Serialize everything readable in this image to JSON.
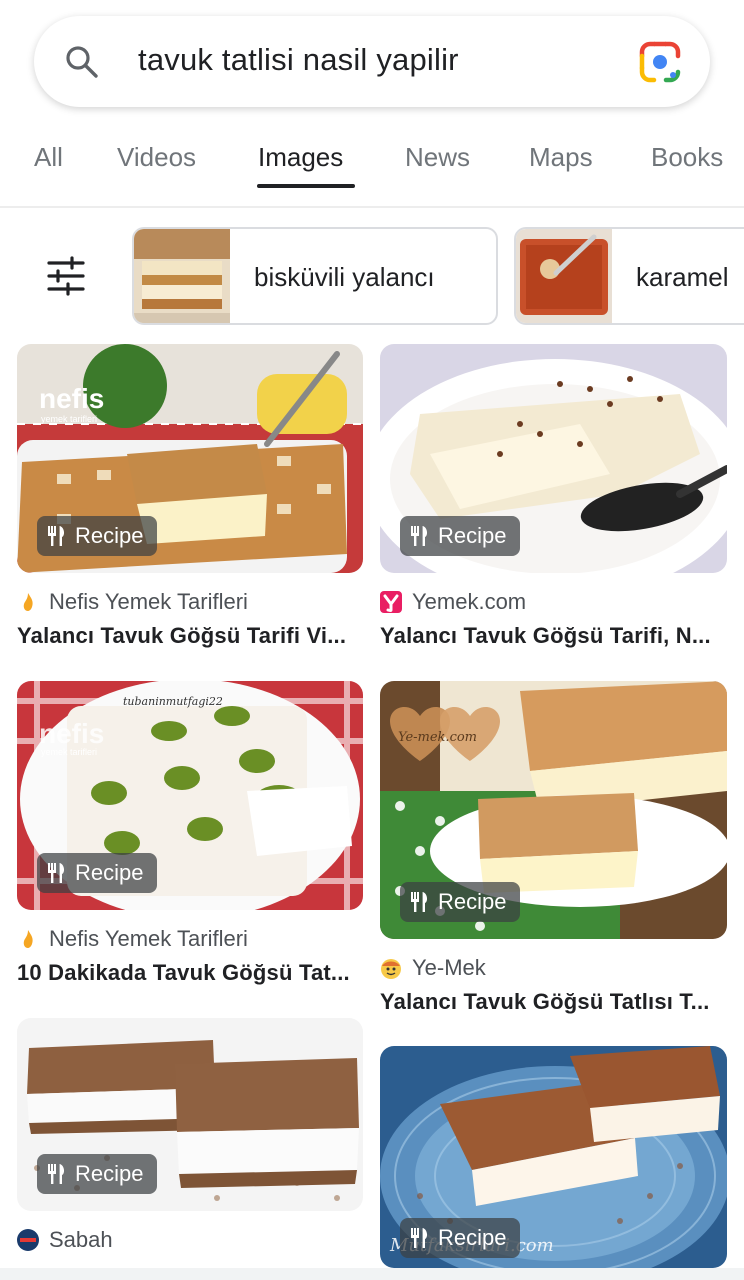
{
  "search": {
    "query": "tavuk tatlisi nasil yapilir"
  },
  "tabs": [
    {
      "label": "All"
    },
    {
      "label": "Videos"
    },
    {
      "label": "Images"
    },
    {
      "label": "News"
    },
    {
      "label": "Maps"
    },
    {
      "label": "Books"
    }
  ],
  "active_tab": "Images",
  "chips": [
    {
      "label": "bisküvili yalancı"
    },
    {
      "label": "karamel"
    }
  ],
  "results": [
    {
      "badge": "Recipe",
      "source": "Nefis Yemek Tarifleri",
      "title": "Yalancı Tavuk Göğsü Tarifi Vi..."
    },
    {
      "badge": "Recipe",
      "source": "Yemek.com",
      "title": "Yalancı Tavuk Göğsü Tarifi, N..."
    },
    {
      "badge": "Recipe",
      "source": "Nefis Yemek Tarifleri",
      "title": "10 Dakikada Tavuk Göğsü Tat..."
    },
    {
      "badge": "Recipe",
      "source": "Ye-Mek",
      "title": "Yalancı Tavuk Göğsü Tatlısı T..."
    },
    {
      "badge": "Recipe",
      "source": "Sabah",
      "title": ""
    },
    {
      "badge": "Recipe",
      "source": "",
      "title": ""
    }
  ],
  "image_text": {
    "nefis_logo": "nefis",
    "nefis_sub": "yemek tarifleri",
    "yemek_watermark": "Ye-mek.com",
    "mutfak_watermark": "Mutfaksirlari.com",
    "insta_handle": "tubaninmutfagi22"
  },
  "colors": {
    "accent_text": "#202124",
    "muted_text": "#70757a",
    "badge_bg": "#3c4043",
    "nefis_orange": "#f5a623",
    "yemek_magenta": "#e91e63"
  },
  "icons": {
    "search": "search-icon",
    "lens": "google-lens-icon",
    "filter": "tune-filter-icon",
    "recipe": "fork-knife-icon"
  }
}
